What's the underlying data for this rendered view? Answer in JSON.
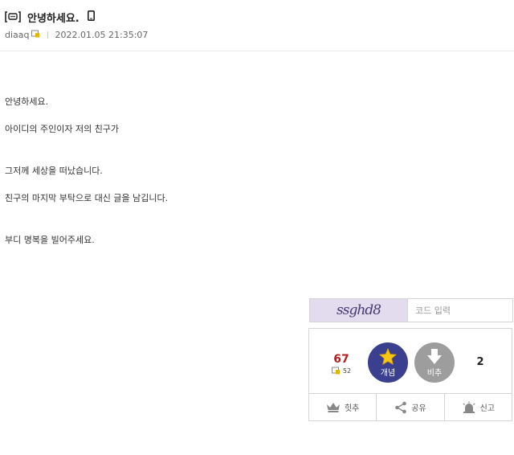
{
  "post": {
    "tag_icon": "speech-bubble-icon",
    "title": "안녕하세요.",
    "device_icon": "mobile-phone-icon",
    "author": "diaaq",
    "datetime": "2022.01.05 21:35:07"
  },
  "body_lines": [
    "안녕하세요.",
    "아이디의 주인이자 저의 친구가",
    "그저께 세상을 떠났습니다.",
    "친구의 마지막 부탁으로 대신 글을 남깁니다.",
    "부디 명복을 빌어주세요."
  ],
  "captcha": {
    "code_image_text": "ssghd8",
    "input_placeholder": "코드 입력",
    "input_value": ""
  },
  "vote": {
    "upvotes": "67",
    "fixed_upvotes": "52",
    "upvote_label": "개념",
    "downvote_label": "비추",
    "downvotes": "2",
    "colors": {
      "upvote": "#3a3f8f",
      "downvote": "#9d9d9d",
      "upcount": "#b12121"
    }
  },
  "actions": {
    "recommend_label": "힛추",
    "share_label": "공유",
    "report_label": "신고"
  }
}
